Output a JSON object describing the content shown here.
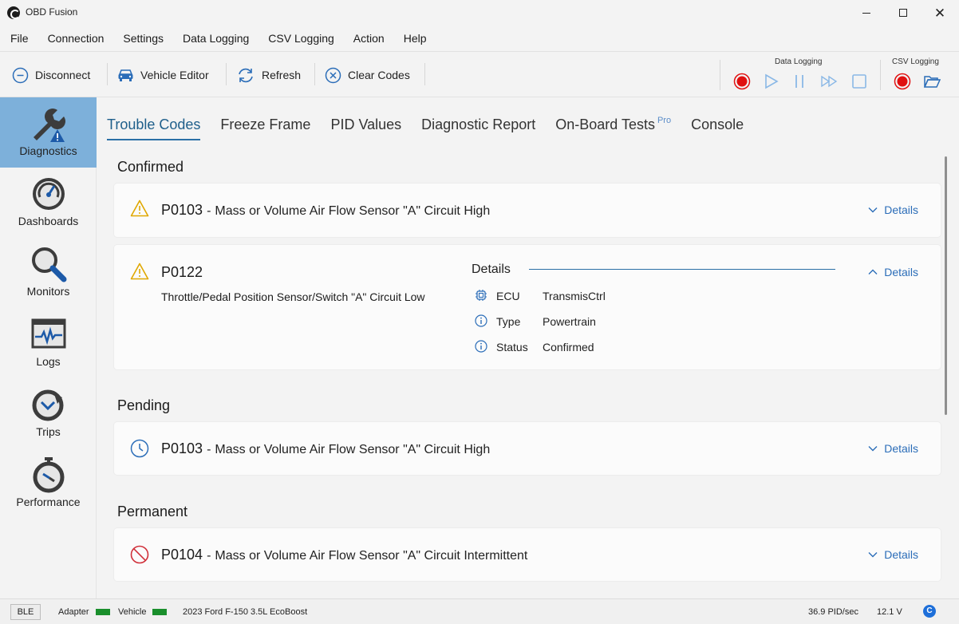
{
  "window": {
    "title": "OBD Fusion"
  },
  "menu": [
    "File",
    "Connection",
    "Settings",
    "Data Logging",
    "CSV Logging",
    "Action",
    "Help"
  ],
  "toolbar": {
    "disconnect": "Disconnect",
    "vehicle_editor": "Vehicle Editor",
    "refresh": "Refresh",
    "clear_codes": "Clear Codes",
    "data_logging_label": "Data Logging",
    "csv_logging_label": "CSV Logging"
  },
  "sidebar": [
    {
      "label": "Diagnostics",
      "active": true
    },
    {
      "label": "Dashboards"
    },
    {
      "label": "Monitors"
    },
    {
      "label": "Logs"
    },
    {
      "label": "Trips"
    },
    {
      "label": "Performance"
    }
  ],
  "tabs": [
    "Trouble Codes",
    "Freeze Frame",
    "PID Values",
    "Diagnostic Report",
    "On-Board Tests",
    "Console"
  ],
  "pro_badge": "Pro",
  "sections": {
    "confirmed": "Confirmed",
    "pending": "Pending",
    "permanent": "Permanent"
  },
  "codes": {
    "confirmed_1": {
      "code": "P0103",
      "dash": "-",
      "desc": "Mass or Volume Air Flow Sensor \"A\" Circuit High"
    },
    "confirmed_2": {
      "code": "P0122",
      "desc": "Throttle/Pedal Position Sensor/Switch \"A\" Circuit Low",
      "details_title": "Details",
      "ecu_key": "ECU",
      "ecu_val": "TransmisCtrl",
      "type_key": "Type",
      "type_val": "Powertrain",
      "status_key": "Status",
      "status_val": "Confirmed"
    },
    "pending_1": {
      "code": "P0103",
      "dash": "-",
      "desc": "Mass or Volume Air Flow Sensor \"A\" Circuit High"
    },
    "permanent_1": {
      "code": "P0104",
      "dash": "-",
      "desc": "Mass or Volume Air Flow Sensor \"A\" Circuit Intermittent"
    }
  },
  "details_label": "Details",
  "status": {
    "ble": "BLE",
    "adapter": "Adapter",
    "vehicle": "Vehicle",
    "vehicle_name": "2023 Ford F-150 3.5L EcoBoost",
    "pid_rate": "36.9 PID/sec",
    "voltage": "12.1 V",
    "c_badge": "C"
  },
  "colors": {
    "accent": "#2b6db8",
    "sidebar_active": "#7db0da",
    "record": "#e01010",
    "warning": "#e0a800",
    "led": "#1a8f2c"
  }
}
